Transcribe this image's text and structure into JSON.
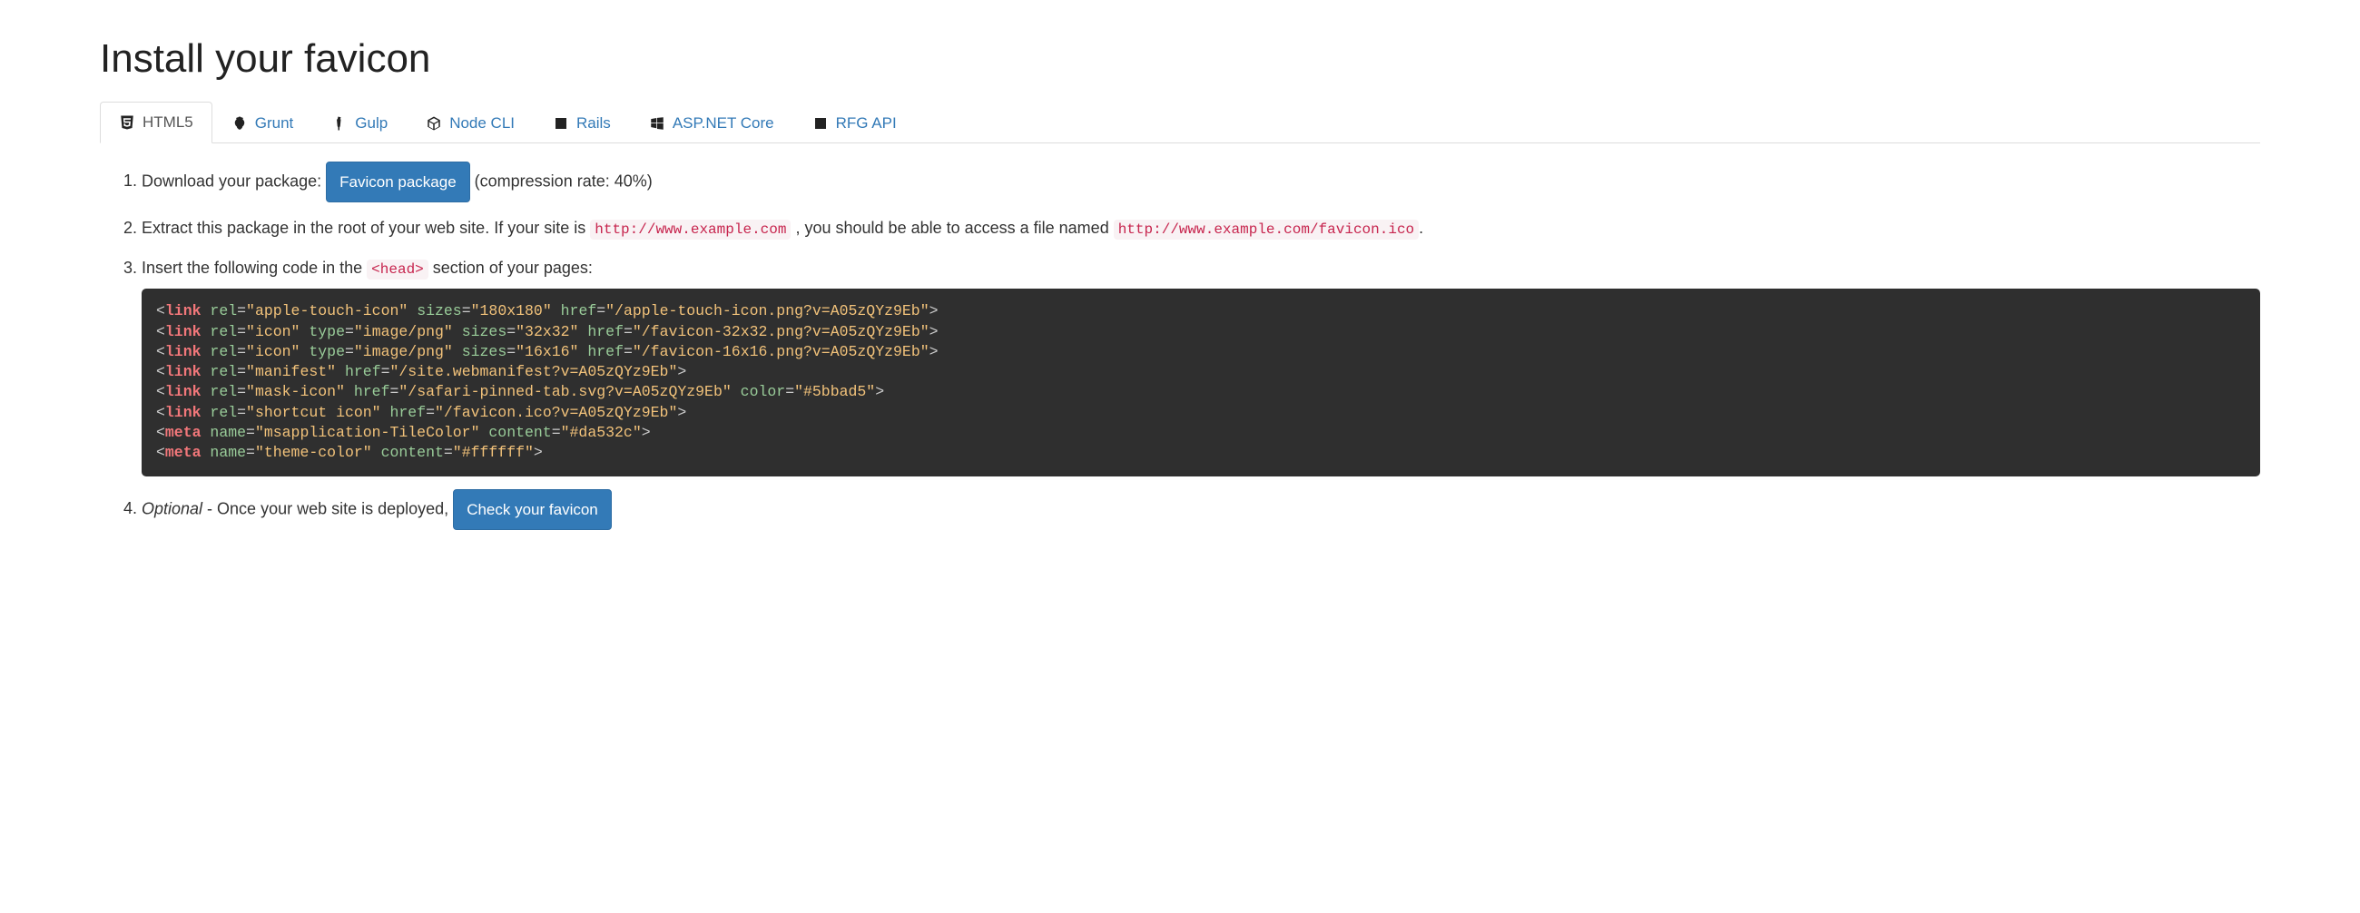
{
  "title": "Install your favicon",
  "tabs": [
    {
      "label": "HTML5"
    },
    {
      "label": "Grunt"
    },
    {
      "label": "Gulp"
    },
    {
      "label": "Node CLI"
    },
    {
      "label": "Rails"
    },
    {
      "label": "ASP.NET Core"
    },
    {
      "label": "RFG API"
    }
  ],
  "step1": {
    "prefix": "Download your package: ",
    "button": "Favicon package",
    "suffix": " (compression rate: 40%)"
  },
  "step2": {
    "prefix": "Extract this package in the root of your web site. If your site is ",
    "code1": "http://www.example.com",
    "mid": ", you should be able to access a file named ",
    "code2": "http://www.example.com/favicon.ico",
    "suffix": "."
  },
  "step3": {
    "prefix": "Insert the following code in the ",
    "code": "<head>",
    "suffix": " section of your pages:"
  },
  "step4": {
    "optional": "Optional",
    "mid": " - Once your web site is deployed, ",
    "button": "Check your favicon"
  },
  "code_lines": [
    {
      "tag": "link",
      "attrs": [
        [
          "rel",
          "apple-touch-icon"
        ],
        [
          "sizes",
          "180x180"
        ],
        [
          "href",
          "/apple-touch-icon.png?v=A05zQYz9Eb"
        ]
      ]
    },
    {
      "tag": "link",
      "attrs": [
        [
          "rel",
          "icon"
        ],
        [
          "type",
          "image/png"
        ],
        [
          "sizes",
          "32x32"
        ],
        [
          "href",
          "/favicon-32x32.png?v=A05zQYz9Eb"
        ]
      ]
    },
    {
      "tag": "link",
      "attrs": [
        [
          "rel",
          "icon"
        ],
        [
          "type",
          "image/png"
        ],
        [
          "sizes",
          "16x16"
        ],
        [
          "href",
          "/favicon-16x16.png?v=A05zQYz9Eb"
        ]
      ]
    },
    {
      "tag": "link",
      "attrs": [
        [
          "rel",
          "manifest"
        ],
        [
          "href",
          "/site.webmanifest?v=A05zQYz9Eb"
        ]
      ]
    },
    {
      "tag": "link",
      "attrs": [
        [
          "rel",
          "mask-icon"
        ],
        [
          "href",
          "/safari-pinned-tab.svg?v=A05zQYz9Eb"
        ],
        [
          "color",
          "#5bbad5"
        ]
      ]
    },
    {
      "tag": "link",
      "attrs": [
        [
          "rel",
          "shortcut icon"
        ],
        [
          "href",
          "/favicon.ico?v=A05zQYz9Eb"
        ]
      ]
    },
    {
      "tag": "meta",
      "attrs": [
        [
          "name",
          "msapplication-TileColor"
        ],
        [
          "content",
          "#da532c"
        ]
      ]
    },
    {
      "tag": "meta",
      "attrs": [
        [
          "name",
          "theme-color"
        ],
        [
          "content",
          "#ffffff"
        ]
      ]
    }
  ]
}
